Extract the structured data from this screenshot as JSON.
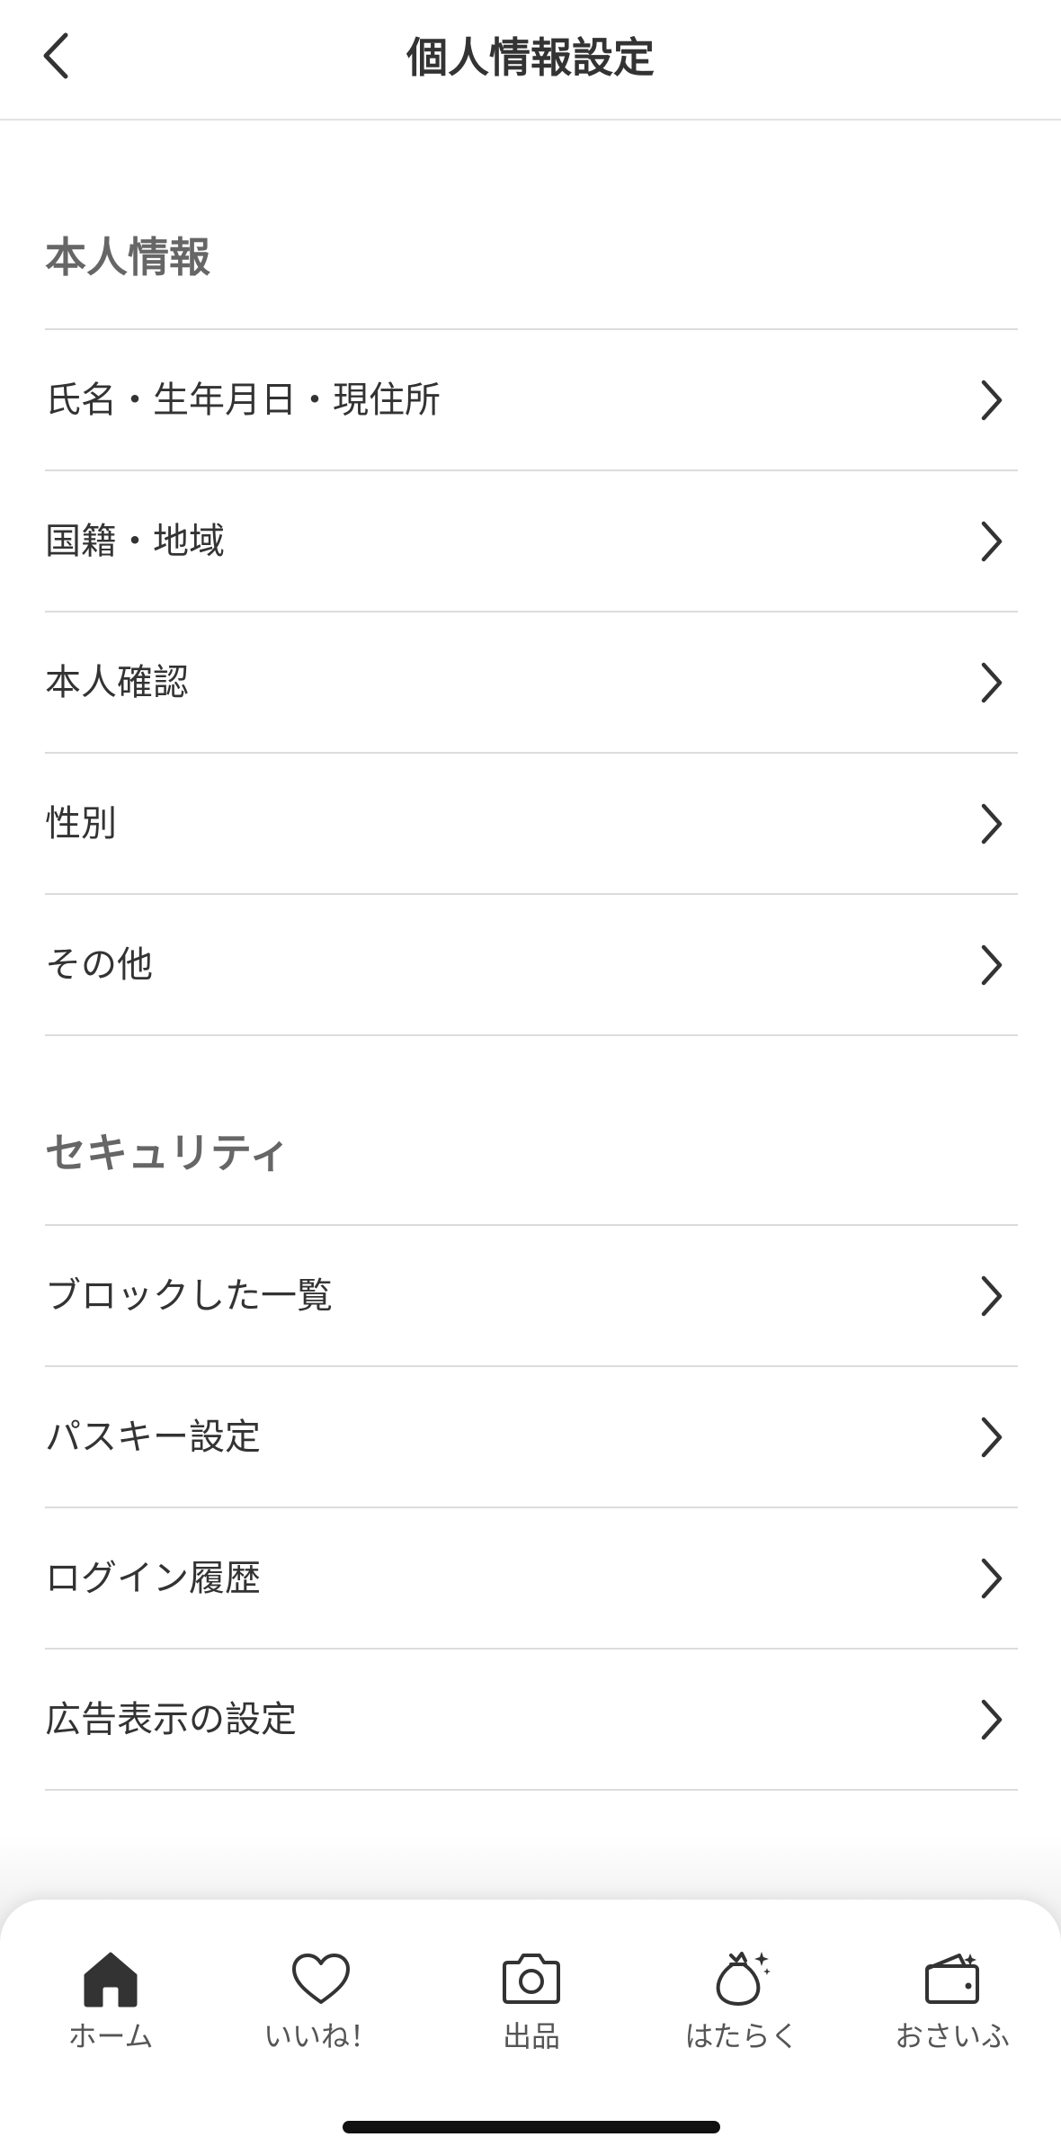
{
  "header": {
    "title": "個人情報設定"
  },
  "sections": [
    {
      "title": "本人情報",
      "items": [
        {
          "label": "氏名・生年月日・現住所"
        },
        {
          "label": "国籍・地域"
        },
        {
          "label": "本人確認"
        },
        {
          "label": "性別"
        },
        {
          "label": "その他"
        }
      ]
    },
    {
      "title": "セキュリティ",
      "items": [
        {
          "label": "ブロックした一覧"
        },
        {
          "label": "パスキー設定"
        },
        {
          "label": "ログイン履歴"
        },
        {
          "label": "広告表示の設定"
        }
      ]
    }
  ],
  "tabbar": {
    "items": [
      {
        "label": "ホーム",
        "icon": "home-icon"
      },
      {
        "label": "いいね！",
        "icon": "heart-icon"
      },
      {
        "label": "出品",
        "icon": "camera-icon"
      },
      {
        "label": "はたらく",
        "icon": "money-bag-icon"
      },
      {
        "label": "おさいふ",
        "icon": "wallet-icon"
      }
    ]
  }
}
